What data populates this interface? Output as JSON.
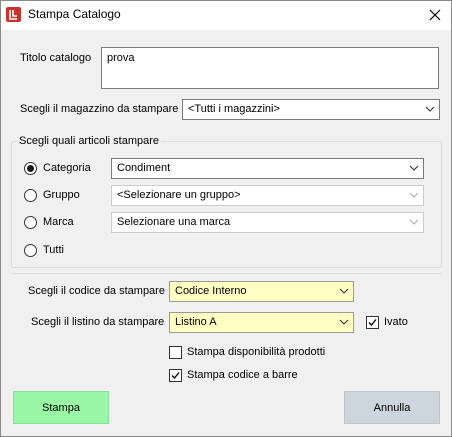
{
  "window": {
    "title": "Stampa Catalogo"
  },
  "titolo": {
    "label": "Titolo catalogo",
    "value": "prova"
  },
  "magazzino": {
    "label": "Scegli il magazzino da stampare",
    "value": "<Tutti i magazzini>"
  },
  "articoli": {
    "group_title": "Scegli quali articoli stampare",
    "options": [
      {
        "label": "Categoria",
        "checked": true,
        "combo": "Condiment",
        "enabled": true
      },
      {
        "label": "Gruppo",
        "checked": false,
        "combo": "<Selezionare un gruppo>",
        "enabled": false
      },
      {
        "label": "Marca",
        "checked": false,
        "combo": "Selezionare una marca",
        "enabled": false
      },
      {
        "label": "Tutti",
        "checked": false
      }
    ]
  },
  "codice": {
    "label": "Scegli il codice da stampare",
    "value": "Codice Interno"
  },
  "listino": {
    "label": "Scegli il listino da stampare",
    "value": "Listino A",
    "ivato_label": "Ivato",
    "ivato_checked": true
  },
  "checkboxes": {
    "disponibilita": {
      "label": "Stampa disponibilità prodotti",
      "checked": false
    },
    "codice_barre": {
      "label": "Stampa codice a barre",
      "checked": true
    }
  },
  "buttons": {
    "stampa": "Stampa",
    "annulla": "Annulla"
  },
  "colors": {
    "stampa_bg": "#99f7a6",
    "annulla_bg": "#cdd6df",
    "highlight_field": "#ffffc4",
    "app_icon": "#c8342c"
  }
}
